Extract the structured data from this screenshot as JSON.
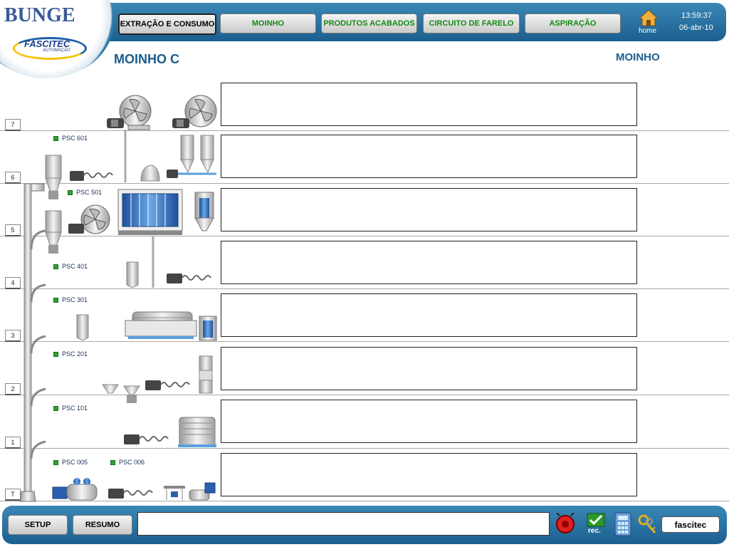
{
  "brand": {
    "logo_main": "BUNGE",
    "logo_partner": "FASCITEC",
    "logo_partner_sub": "AUTOMAÇÃO"
  },
  "nav": {
    "items": [
      {
        "label": "EXTRAÇÃO E CONSUMO",
        "active": true
      },
      {
        "label": "MOINHO",
        "active": false
      },
      {
        "label": "PRODUTOS ACABADOS",
        "active": false
      },
      {
        "label": "CIRCUITO DE FARELO",
        "active": false
      },
      {
        "label": "ASPIRAÇÃO",
        "active": false
      }
    ],
    "home_label": "home",
    "time": "13:59:37",
    "date": "06-abr-10"
  },
  "page": {
    "title": "MOINHO C",
    "section": "MOINHO"
  },
  "floors": [
    {
      "label": "7",
      "sensors": []
    },
    {
      "label": "6",
      "sensors": [
        "PSC 601"
      ]
    },
    {
      "label": "5",
      "sensors": [
        "PSC 501"
      ]
    },
    {
      "label": "4",
      "sensors": [
        "PSC 401"
      ]
    },
    {
      "label": "3",
      "sensors": [
        "PSC 301"
      ]
    },
    {
      "label": "2",
      "sensors": [
        "PSC 201"
      ]
    },
    {
      "label": "1",
      "sensors": [
        "PSC 101"
      ]
    },
    {
      "label": "T",
      "sensors": [
        "PSC 005",
        "PSC 006"
      ]
    }
  ],
  "footer": {
    "setup_label": "SETUP",
    "resumo_label": "RESUMO",
    "message_value": "",
    "rec_label": "rec.",
    "user": "fascitec"
  },
  "colors": {
    "bar_blue": "#1b5f8f",
    "nav_text_green": "#138a13",
    "title_blue": "#1a5d8c",
    "sensor_green": "#2fa02f"
  }
}
